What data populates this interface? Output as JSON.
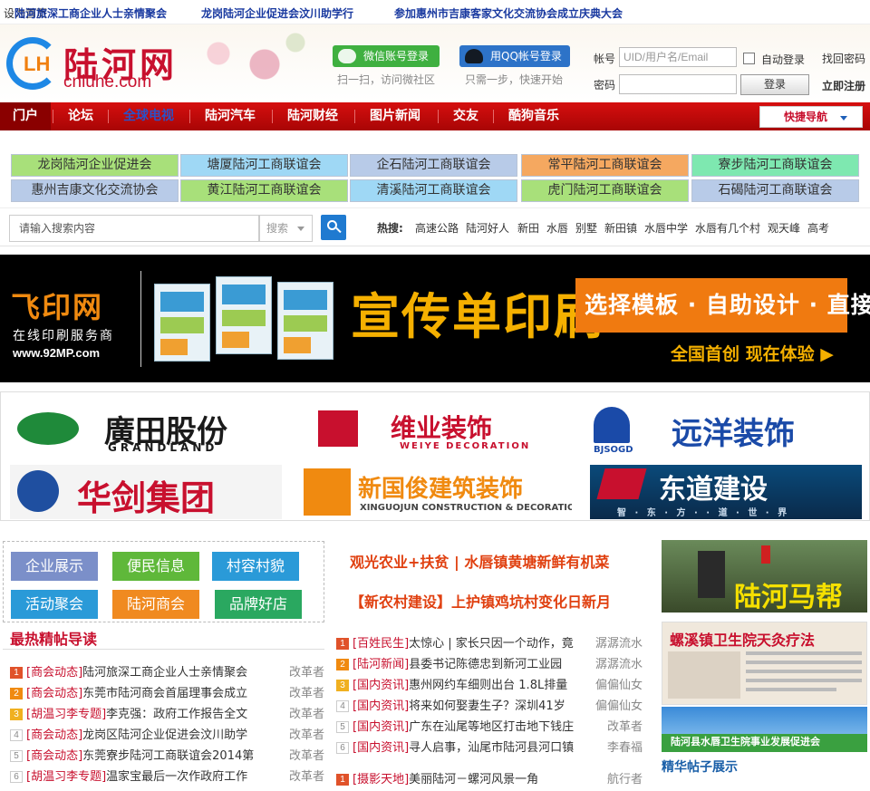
{
  "ticker": [
    "设为首页",
    "陆河旅深工商企业人士亲情聚会",
    "龙岗陆河企业促进会汶川助学行",
    "参加惠州市吉康客家文化交流协会成立庆典大会"
  ],
  "logo": {
    "cn": "陆河网",
    "en": "cnluhe.com",
    "mark": "LH"
  },
  "login": {
    "wechat_btn": "微信账号登录",
    "wechat_hint": "扫一扫，访问微社区",
    "qq_btn": "用QQ帐号登录",
    "qq_hint": "只需一步，快速开始",
    "account_label": "帐号",
    "account_placeholder": "UID/用户名/Email",
    "password_label": "密码",
    "auto_login": "自动登录",
    "find_password": "找回密码",
    "login_btn": "登录",
    "register": "立即注册"
  },
  "nav": {
    "items": [
      "门户",
      "论坛",
      "全球电视",
      "陆河汽车",
      "陆河财经",
      "图片新闻",
      "交友",
      "酷狗音乐"
    ],
    "quick": "快捷导航"
  },
  "associations": [
    {
      "label": "龙岗陆河企业促进会",
      "color": "#a8e07a"
    },
    {
      "label": "塘厦陆河工商联谊会",
      "color": "#9fd8f5"
    },
    {
      "label": "企石陆河工商联谊会",
      "color": "#b8cbe8"
    },
    {
      "label": "常平陆河工商联谊会",
      "color": "#f5a860"
    },
    {
      "label": "寮步陆河工商联谊会",
      "color": "#7ee8b0"
    },
    {
      "label": "惠州吉康文化交流协会",
      "color": "#b8cbe8"
    },
    {
      "label": "黄江陆河工商联谊会",
      "color": "#a8e07a"
    },
    {
      "label": "清溪陆河工商联谊会",
      "color": "#9fd8f5"
    },
    {
      "label": "虎门陆河工商联谊会",
      "color": "#a8e07a"
    },
    {
      "label": "石碣陆河工商联谊会",
      "color": "#b8cbe8"
    }
  ],
  "search": {
    "placeholder": "请输入搜索内容",
    "type": "搜索",
    "hot_label": "热搜:",
    "hot": [
      "高速公路",
      "陆河好人",
      "新田",
      "水唇",
      "别墅",
      "新田镇",
      "水唇中学",
      "水唇有几个村",
      "观天峰",
      "高考"
    ]
  },
  "print_banner": {
    "brand": "飞印网",
    "sub": "在线印刷服务商",
    "url": "www.92MP.com",
    "title": "宣传单印刷",
    "slogan": "选择模板 · 自助设计 · 直接下单",
    "first": "全国首创  现在体验"
  },
  "sponsors": [
    {
      "name": "廣田股份",
      "sub": "GRANDLAND"
    },
    {
      "name": "维业装饰",
      "sub": "WEIYE DECORATION"
    },
    {
      "name": "远洋装饰",
      "sub": "BJSOGD"
    },
    {
      "name": "华剑集团",
      "sub": ""
    },
    {
      "name": "新国俊建筑装饰",
      "sub": "XINGUOJUN CONSTRUCTION & DECORATION"
    },
    {
      "name": "东道建设",
      "sub": "智 · 东 · 方 · · 道 · 世 · 界"
    }
  ],
  "tiles": [
    {
      "label": "企业展示",
      "color": "#7b8fc9"
    },
    {
      "label": "便民信息",
      "color": "#5fb83a"
    },
    {
      "label": "村容村貌",
      "color": "#2a9ad8"
    },
    {
      "label": "活动聚会",
      "color": "#2a9ad8"
    },
    {
      "label": "陆河商会",
      "color": "#f08a20"
    },
    {
      "label": "品牌好店",
      "color": "#2aa860"
    }
  ],
  "hot_posts_title": "最热精帖导读",
  "hot_posts": [
    {
      "n": "1",
      "cat": "[商会动态]",
      "title": "陆河旅深工商企业人士亲情聚会",
      "author": "改革者"
    },
    {
      "n": "2",
      "cat": "[商会动态]",
      "title": "东莞市陆河商会首届理事会成立",
      "author": "改革者"
    },
    {
      "n": "3",
      "cat": "[胡温习李专题]",
      "title": "李克强：政府工作报告全文",
      "author": "改革者"
    },
    {
      "n": "4",
      "cat": "[商会动态]",
      "title": "龙岗区陆河企业促进会汶川助学",
      "author": "改革者"
    },
    {
      "n": "5",
      "cat": "[商会动态]",
      "title": "东莞寮步陆河工商联谊会2014第",
      "author": "改革者"
    },
    {
      "n": "6",
      "cat": "[胡温习李专题]",
      "title": "温家宝最后一次作政府工作",
      "author": "改革者"
    }
  ],
  "headlines": [
    "观光农业+扶贫 | 水唇镇黄塘新鲜有机菜",
    "【新农村建设】上护镇鸡坑村变化日新月"
  ],
  "news": [
    {
      "n": "1",
      "cat": "[百姓民生]",
      "title": "太惊心 | 家长只因一个动作，竟",
      "author": "潺潺流水"
    },
    {
      "n": "2",
      "cat": "[陆河新闻]",
      "title": "县委书记陈德忠到新河工业园",
      "author": "潺潺流水"
    },
    {
      "n": "3",
      "cat": "[国内资讯]",
      "title": "惠州网约车细则出台 1.8L排量",
      "author": "偏偏仙女"
    },
    {
      "n": "4",
      "cat": "[国内资讯]",
      "title": "将来如何娶妻生子？深圳41岁",
      "author": "偏偏仙女"
    },
    {
      "n": "5",
      "cat": "[国内资讯]",
      "title": "广东在汕尾等地区打击地下钱庄",
      "author": "改革者"
    },
    {
      "n": "6",
      "cat": "[国内资讯]",
      "title": "寻人启事，汕尾市陆河县河口镇",
      "author": "李春福"
    },
    {
      "n": "1",
      "cat": "[摄影天地]",
      "title": "美丽陆河－螺河风景一角",
      "author": "航行者"
    }
  ],
  "right": {
    "img1_caption": "陆河马帮",
    "img2_title": "螺溪镇卫生院天灸疗法",
    "img3_title": "陆河县水唇卫生院事业发展促进会",
    "section_title": "精华帖子展示"
  },
  "colors": {
    "nav_red": "#c8102e",
    "brand_orange": "#f08a10",
    "link_blue": "#1a3aa0"
  }
}
